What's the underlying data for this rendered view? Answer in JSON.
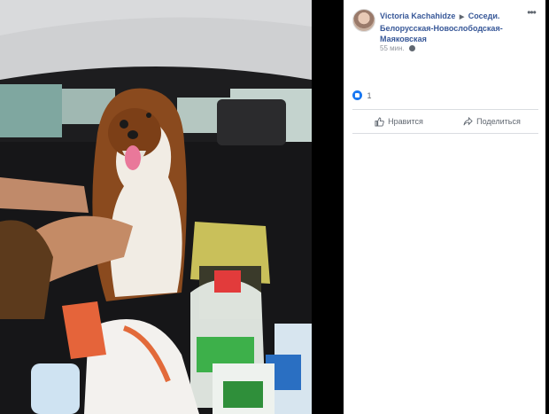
{
  "post": {
    "author": "Victoria Kachahidze",
    "separator": "▶",
    "group": "Соседи. Белорусская-Новослободская-Маяковская",
    "time": "55 мин."
  },
  "reactions": {
    "count": "1"
  },
  "actions": {
    "like": "Нравится",
    "share": "Поделиться"
  },
  "icons": {
    "more": "more-options-icon",
    "privacy": "globe-icon",
    "reaction": "like-reaction-icon",
    "like": "thumbs-up-icon",
    "share": "share-arrow-icon"
  },
  "colors": {
    "link": "#385898",
    "muted": "#606770",
    "accent": "#1877f2"
  }
}
